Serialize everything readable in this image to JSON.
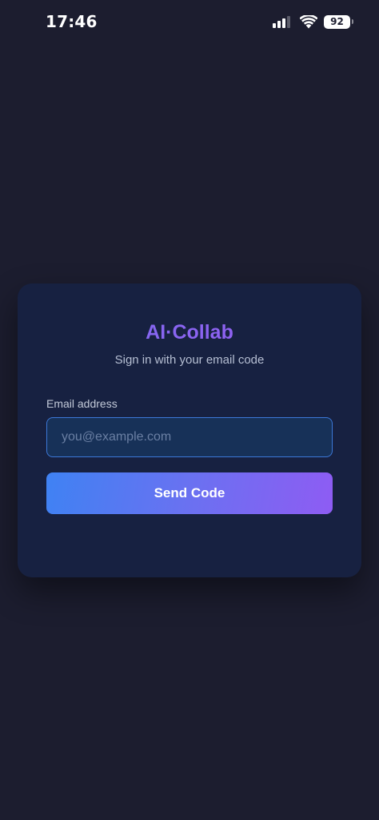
{
  "status_bar": {
    "time": "17:46",
    "signal_icon": "cellular-signal-icon",
    "wifi_icon": "wifi-icon",
    "battery_level": "92"
  },
  "login_card": {
    "title": "AI·Collab",
    "subtitle": "Sign in with your email code",
    "email_label": "Email address",
    "email_value": "",
    "email_placeholder": "you@example.com",
    "send_button_label": "Send Code"
  },
  "colors": {
    "background": "#1c1d2f",
    "card": "#172141",
    "title_gradient_start": "#7a6cf2",
    "title_gradient_end": "#9a5cf0",
    "input_border": "#3c78d8",
    "button_gradient_start": "#3f82f3",
    "button_gradient_end": "#8e5cf3"
  }
}
